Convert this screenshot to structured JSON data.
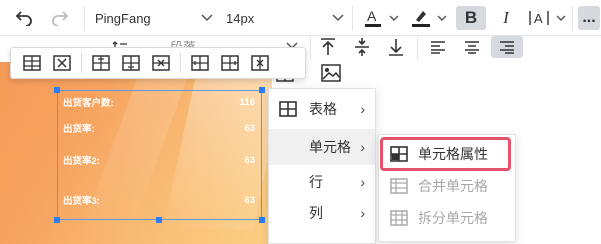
{
  "toolbar": {
    "undo_icon": "undo-icon",
    "redo_icon": "redo-icon",
    "font_family": "PingFang",
    "font_size": "14px",
    "bold": "B",
    "italic": "I",
    "more": "..."
  },
  "toolbar2": {
    "paragraph": "段落"
  },
  "table": {
    "rows": [
      {
        "label": "出货客户数:",
        "value": "116"
      },
      {
        "label": "出货率:",
        "value": "63"
      },
      {
        "label": "出货率2:",
        "value": "63"
      },
      {
        "label": "出货率3:",
        "value": "63"
      }
    ]
  },
  "context_menu": {
    "items": [
      {
        "label": "表格",
        "has_icon": true
      },
      {
        "label": "单元格",
        "highlighted": true
      },
      {
        "label": "行"
      },
      {
        "label": "列"
      }
    ]
  },
  "submenu": {
    "items": [
      {
        "label": "单元格属性",
        "enabled": true
      },
      {
        "label": "合并单元格",
        "enabled": false
      },
      {
        "label": "拆分单元格",
        "enabled": false
      }
    ]
  },
  "colors": {
    "accent_highlight": "#e5526b",
    "selection_blue": "#2f7df6",
    "orange_bg": "#f6a35f"
  }
}
